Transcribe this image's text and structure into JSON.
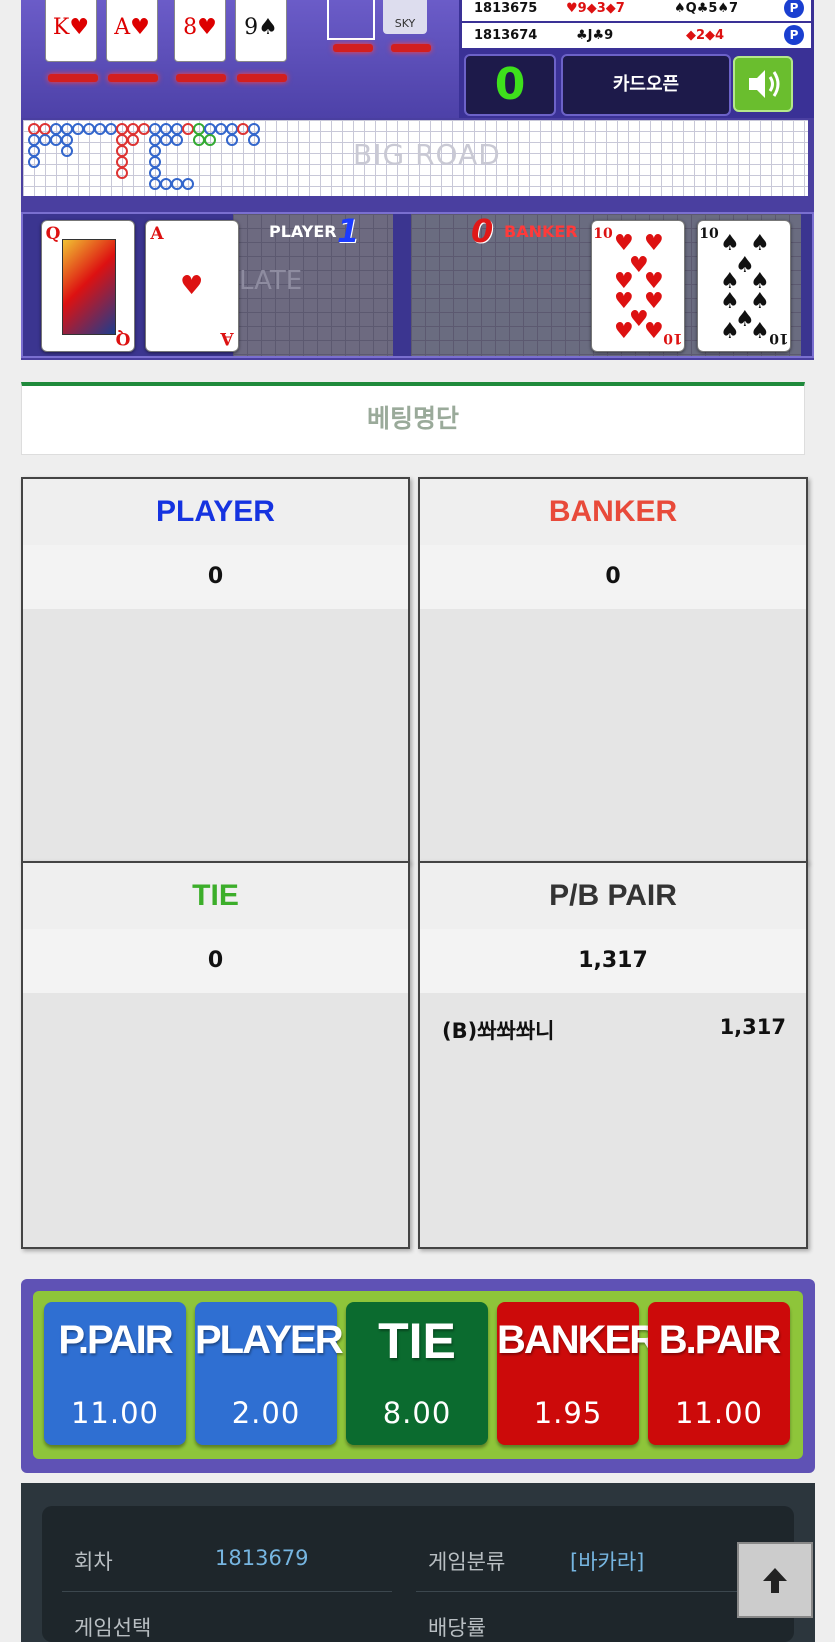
{
  "history": [
    {
      "round": "1813675",
      "player": "♥9◆3◆7",
      "banker": "♠Q♣5♠7",
      "result": "P"
    },
    {
      "round": "1813674",
      "player": "♣J♣9",
      "banker": "◆2◆4",
      "result": "P"
    }
  ],
  "counter": "0",
  "card_open_label": "카드오픈",
  "sound_icon": "speaker-icon",
  "table_top_cards": [
    "K♥",
    "A♥",
    "8♥",
    "9♠"
  ],
  "shoe_label": "SKY",
  "big_road_label": "BIG ROAD",
  "plate_label": "LATE",
  "deal": {
    "player_label": "PLAYER",
    "player_score": "1",
    "banker_label": "BANKER",
    "banker_score": "0",
    "player_cards": [
      {
        "rank": "Q",
        "suit": "♥",
        "color": "#d11"
      },
      {
        "rank": "A",
        "suit": "♥",
        "color": "#d11"
      }
    ],
    "banker_cards": [
      {
        "rank": "10",
        "suit": "♥",
        "color": "#d11"
      },
      {
        "rank": "10",
        "suit": "♠",
        "color": "#111"
      }
    ]
  },
  "betting_list_title": "베팅명단",
  "panels": {
    "player": {
      "title": "PLAYER",
      "color": "#1533e0",
      "total": "0"
    },
    "banker": {
      "title": "BANKER",
      "color": "#e84a3a",
      "total": "0"
    },
    "tie": {
      "title": "TIE",
      "color": "#3cae2a",
      "total": "0"
    },
    "pair": {
      "title": "P/B PAIR",
      "color": "#333333",
      "total": "1,317",
      "entries": [
        {
          "name": "(B)쏴쏴쏴니",
          "amount": "1,317"
        }
      ]
    }
  },
  "odds": [
    {
      "name": "P.PAIR",
      "value": "11.00",
      "color": "#2f6fd2"
    },
    {
      "name": "PLAYER",
      "value": "2.00",
      "color": "#2f6fd2"
    },
    {
      "name": "TIE",
      "value": "8.00",
      "color": "#0b6b2f"
    },
    {
      "name": "BANKER",
      "value": "1.95",
      "color": "#cc0a0a"
    },
    {
      "name": "B.PAIR",
      "value": "11.00",
      "color": "#cc0a0a"
    }
  ],
  "info": {
    "round_label": "회차",
    "round_value": "1813679",
    "category_label": "게임분류",
    "category_value": "[바카라]",
    "select_label": "게임선택",
    "rate_label": "배당률"
  },
  "scroll_top_icon": "arrow-up-icon"
}
